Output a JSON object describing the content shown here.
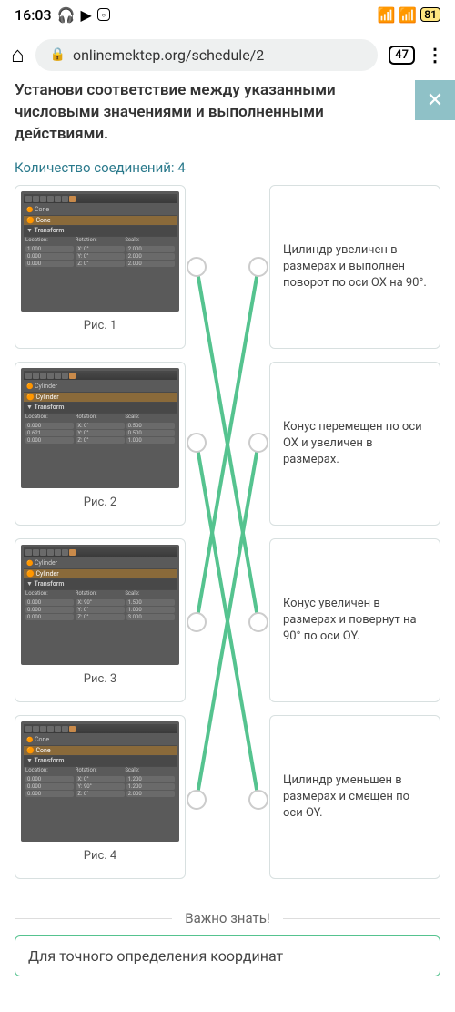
{
  "status": {
    "time": "16:03",
    "battery": "81"
  },
  "nav": {
    "url": "onlinemektep.org/schedule/2",
    "tab_count": "47"
  },
  "task": {
    "title": "Установи соответствие между указанными числовыми значениями и выполненными действиями.",
    "conn_label": "Количество соединений: 4"
  },
  "left": [
    {
      "caption": "Рис. 1",
      "object": "Cone",
      "loc": [
        "1.000",
        "0.000",
        "0.000"
      ],
      "rot": [
        "X: 0°",
        "Y: 0°",
        "Z: 0°"
      ],
      "scale": [
        "2.000",
        "2.000",
        "2.000"
      ]
    },
    {
      "caption": "Рис. 2",
      "object": "Cylinder",
      "loc": [
        "0.000",
        "0.621",
        "0.000"
      ],
      "rot": [
        "X: 0°",
        "Y: 0°",
        "Z: 0°"
      ],
      "scale": [
        "0.500",
        "0.500",
        "1.000"
      ]
    },
    {
      "caption": "Рис. 3",
      "object": "Cylinder",
      "loc": [
        "0.000",
        "0.000",
        "0.000"
      ],
      "rot": [
        "X: 90°",
        "Y: 0°",
        "Z: 0°"
      ],
      "scale": [
        "1.500",
        "1.000",
        "3.000"
      ]
    },
    {
      "caption": "Рис. 4",
      "object": "Cone",
      "loc": [
        "0.000",
        "0.000",
        "0.000"
      ],
      "rot": [
        "X: 0°",
        "Y: 90°",
        "Z: 0°"
      ],
      "scale": [
        "1.200",
        "1.200",
        "2.000"
      ]
    }
  ],
  "right": [
    {
      "text": "Цилиндр увеличен в размерах и выполнен поворот по оси OX на 90°."
    },
    {
      "text": "Конус перемещен по оси OX и увеличен в размерах."
    },
    {
      "text": "Конус увеличен в размерах и повернут на 90° по оси OY."
    },
    {
      "text": "Цилиндр уменьшен в размерах и смещен по оси OY."
    }
  ],
  "important": {
    "heading": "Важно знать!",
    "text": "Для точного определения координат"
  },
  "labels": {
    "transform": "Transform",
    "location": "Location:",
    "rotation": "Rotation:",
    "scale": "Scale:"
  }
}
